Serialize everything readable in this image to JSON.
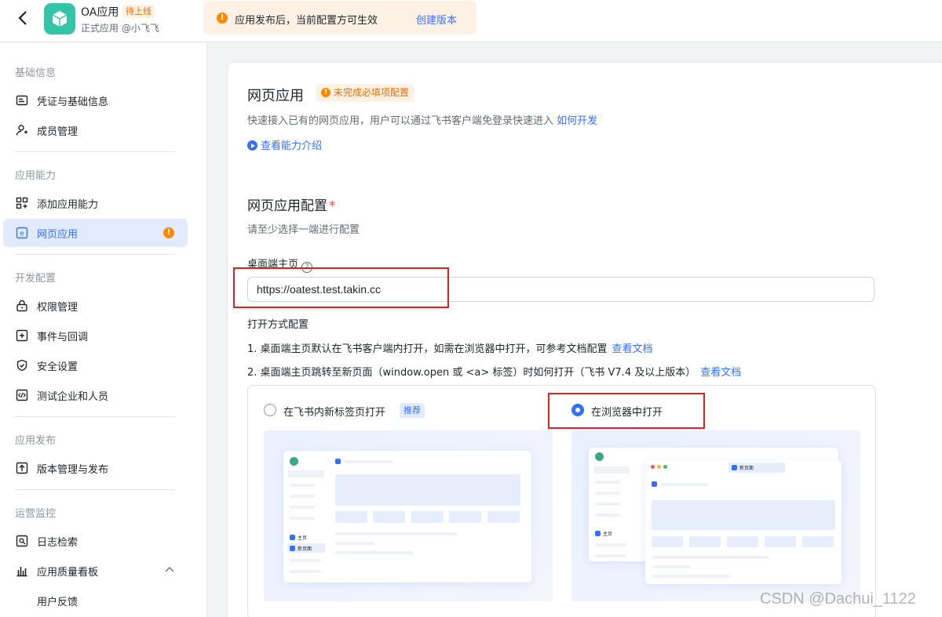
{
  "header": {
    "app_name": "OA应用",
    "app_status": "待上线",
    "app_sub": "正式应用 @小飞飞",
    "notice_text": "应用发布后，当前配置方可生效",
    "notice_link": "创建版本"
  },
  "sidebar": {
    "sections": [
      {
        "title": "基础信息",
        "items": [
          {
            "label": "凭证与基础信息",
            "icon": "id-card-icon"
          },
          {
            "label": "成员管理",
            "icon": "user-add-icon"
          }
        ]
      },
      {
        "title": "应用能力",
        "items": [
          {
            "label": "添加应用能力",
            "icon": "grid-add-icon"
          },
          {
            "label": "网页应用",
            "icon": "web-app-icon",
            "active": true,
            "alert": "!"
          }
        ]
      },
      {
        "title": "开发配置",
        "items": [
          {
            "label": "权限管理",
            "icon": "lock-icon"
          },
          {
            "label": "事件与回调",
            "icon": "event-icon"
          },
          {
            "label": "安全设置",
            "icon": "shield-icon"
          },
          {
            "label": "测试企业和人员",
            "icon": "code-icon"
          }
        ]
      },
      {
        "title": "应用发布",
        "items": [
          {
            "label": "版本管理与发布",
            "icon": "upload-icon"
          }
        ]
      },
      {
        "title": "运营监控",
        "items": [
          {
            "label": "日志检索",
            "icon": "log-search-icon"
          },
          {
            "label": "应用质量看板",
            "icon": "chart-icon"
          },
          {
            "label": "用户反馈",
            "icon": ""
          }
        ]
      }
    ]
  },
  "main": {
    "title": "网页应用",
    "warn_badge": "未完成必填项配置",
    "desc": "快速接入已有的网页应用，用户可以通过飞书客户端免登录快速进入",
    "desc_link": "如何开发",
    "intro_link": "查看能力介绍",
    "config_title": "网页应用配置",
    "required_mark": "*",
    "config_sub": "请至少选择一端进行配置",
    "desktop_label": "桌面端主页",
    "help_glyph": "?",
    "desktop_url": "https://oatest.test.takin.cc",
    "open_title": "打开方式配置",
    "open_line1": "1. 桌面端主页默认在飞书客户端内打开，如需在浏览器中打开，可参考文档配置",
    "open_line2": "2. 桌面端主页跳转至新页面（window.open 或 <a> 标签）时如何打开（飞书 V7.4 及以上版本）",
    "doc_link": "查看文档",
    "option_a": "在飞书内新标签页打开",
    "option_a_tag": "推荐",
    "option_b": "在浏览器中打开",
    "selected_option": "option_b",
    "preview": {
      "home": "主页",
      "new_page": "新页面"
    }
  },
  "watermark": "CSDN @Dachui_1122",
  "colors": {
    "accent": "#3370ff",
    "warning": "#ff8800",
    "highlight_box": "#e02020",
    "app_logo": "#34c5a6"
  }
}
